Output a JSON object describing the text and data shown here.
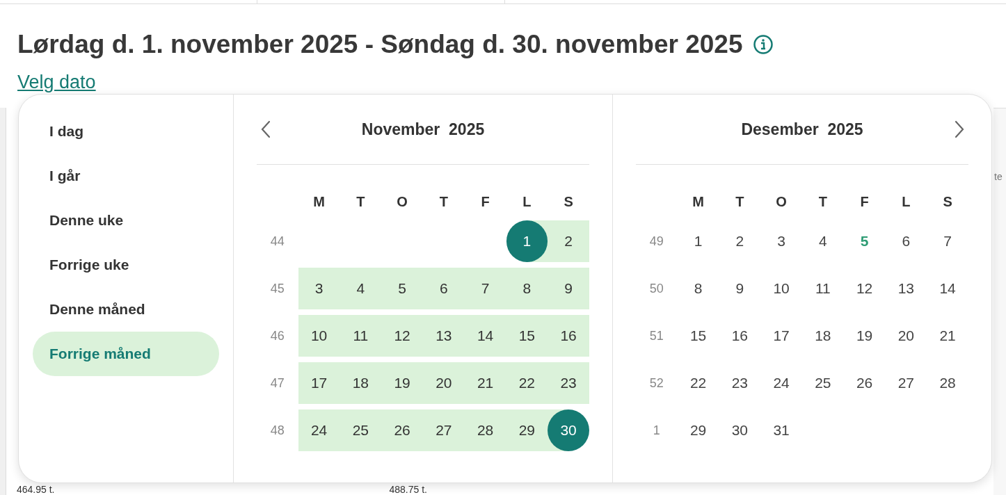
{
  "header": {
    "title": "Lørdag d. 1. november 2025 - Søndag d. 30. november 2025",
    "link": "Velg dato"
  },
  "background": {
    "side_text": "te",
    "values": [
      "464.95 t.",
      "488.75 t."
    ]
  },
  "presets": [
    {
      "label": "I dag",
      "selected": false
    },
    {
      "label": "I går",
      "selected": false
    },
    {
      "label": "Denne uke",
      "selected": false
    },
    {
      "label": "Forrige uke",
      "selected": false
    },
    {
      "label": "Denne måned",
      "selected": false
    },
    {
      "label": "Forrige måned",
      "selected": true
    }
  ],
  "months": [
    {
      "month": "November",
      "year": "2025",
      "weekdays": [
        "M",
        "T",
        "O",
        "T",
        "F",
        "L",
        "S"
      ],
      "weeks": [
        {
          "number": "44",
          "days": [
            {
              "label": "1",
              "kind": "start"
            },
            {
              "label": "2",
              "kind": "range"
            }
          ]
        },
        {
          "number": "45",
          "days": [
            {
              "label": "3",
              "kind": "range"
            },
            {
              "label": "4",
              "kind": "range"
            },
            {
              "label": "5",
              "kind": "range"
            },
            {
              "label": "6",
              "kind": "range"
            },
            {
              "label": "7",
              "kind": "range"
            },
            {
              "label": "8",
              "kind": "range"
            },
            {
              "label": "9",
              "kind": "range"
            }
          ]
        },
        {
          "number": "46",
          "days": [
            {
              "label": "10",
              "kind": "range"
            },
            {
              "label": "11",
              "kind": "range"
            },
            {
              "label": "12",
              "kind": "range"
            },
            {
              "label": "13",
              "kind": "range"
            },
            {
              "label": "14",
              "kind": "range"
            },
            {
              "label": "15",
              "kind": "range"
            },
            {
              "label": "16",
              "kind": "range"
            }
          ]
        },
        {
          "number": "47",
          "days": [
            {
              "label": "17",
              "kind": "range"
            },
            {
              "label": "18",
              "kind": "range"
            },
            {
              "label": "19",
              "kind": "range"
            },
            {
              "label": "20",
              "kind": "range"
            },
            {
              "label": "21",
              "kind": "range"
            },
            {
              "label": "22",
              "kind": "range"
            },
            {
              "label": "23",
              "kind": "range"
            }
          ]
        },
        {
          "number": "48",
          "days": [
            {
              "label": "24",
              "kind": "range"
            },
            {
              "label": "25",
              "kind": "range"
            },
            {
              "label": "26",
              "kind": "range"
            },
            {
              "label": "27",
              "kind": "range"
            },
            {
              "label": "28",
              "kind": "range"
            },
            {
              "label": "29",
              "kind": "range"
            },
            {
              "label": "30",
              "kind": "end"
            }
          ]
        }
      ]
    },
    {
      "month": "Desember",
      "year": "2025",
      "weekdays": [
        "M",
        "T",
        "O",
        "T",
        "F",
        "L",
        "S"
      ],
      "weeks": [
        {
          "number": "49",
          "days": [
            {
              "label": "1",
              "kind": "plain"
            },
            {
              "label": "2",
              "kind": "plain"
            },
            {
              "label": "3",
              "kind": "plain"
            },
            {
              "label": "4",
              "kind": "plain"
            },
            {
              "label": "5",
              "kind": "today"
            },
            {
              "label": "6",
              "kind": "plain"
            },
            {
              "label": "7",
              "kind": "plain"
            }
          ]
        },
        {
          "number": "50",
          "days": [
            {
              "label": "8",
              "kind": "plain"
            },
            {
              "label": "9",
              "kind": "plain"
            },
            {
              "label": "10",
              "kind": "plain"
            },
            {
              "label": "11",
              "kind": "plain"
            },
            {
              "label": "12",
              "kind": "plain"
            },
            {
              "label": "13",
              "kind": "plain"
            },
            {
              "label": "14",
              "kind": "plain"
            }
          ]
        },
        {
          "number": "51",
          "days": [
            {
              "label": "15",
              "kind": "plain"
            },
            {
              "label": "16",
              "kind": "plain"
            },
            {
              "label": "17",
              "kind": "plain"
            },
            {
              "label": "18",
              "kind": "plain"
            },
            {
              "label": "19",
              "kind": "plain"
            },
            {
              "label": "20",
              "kind": "plain"
            },
            {
              "label": "21",
              "kind": "plain"
            }
          ]
        },
        {
          "number": "52",
          "days": [
            {
              "label": "22",
              "kind": "plain"
            },
            {
              "label": "23",
              "kind": "plain"
            },
            {
              "label": "24",
              "kind": "plain"
            },
            {
              "label": "25",
              "kind": "plain"
            },
            {
              "label": "26",
              "kind": "plain"
            },
            {
              "label": "27",
              "kind": "plain"
            },
            {
              "label": "28",
              "kind": "plain"
            }
          ]
        },
        {
          "number": "1",
          "days": [
            {
              "label": "29",
              "kind": "plain"
            },
            {
              "label": "30",
              "kind": "plain"
            },
            {
              "label": "31",
              "kind": "plain"
            }
          ]
        }
      ]
    }
  ]
}
